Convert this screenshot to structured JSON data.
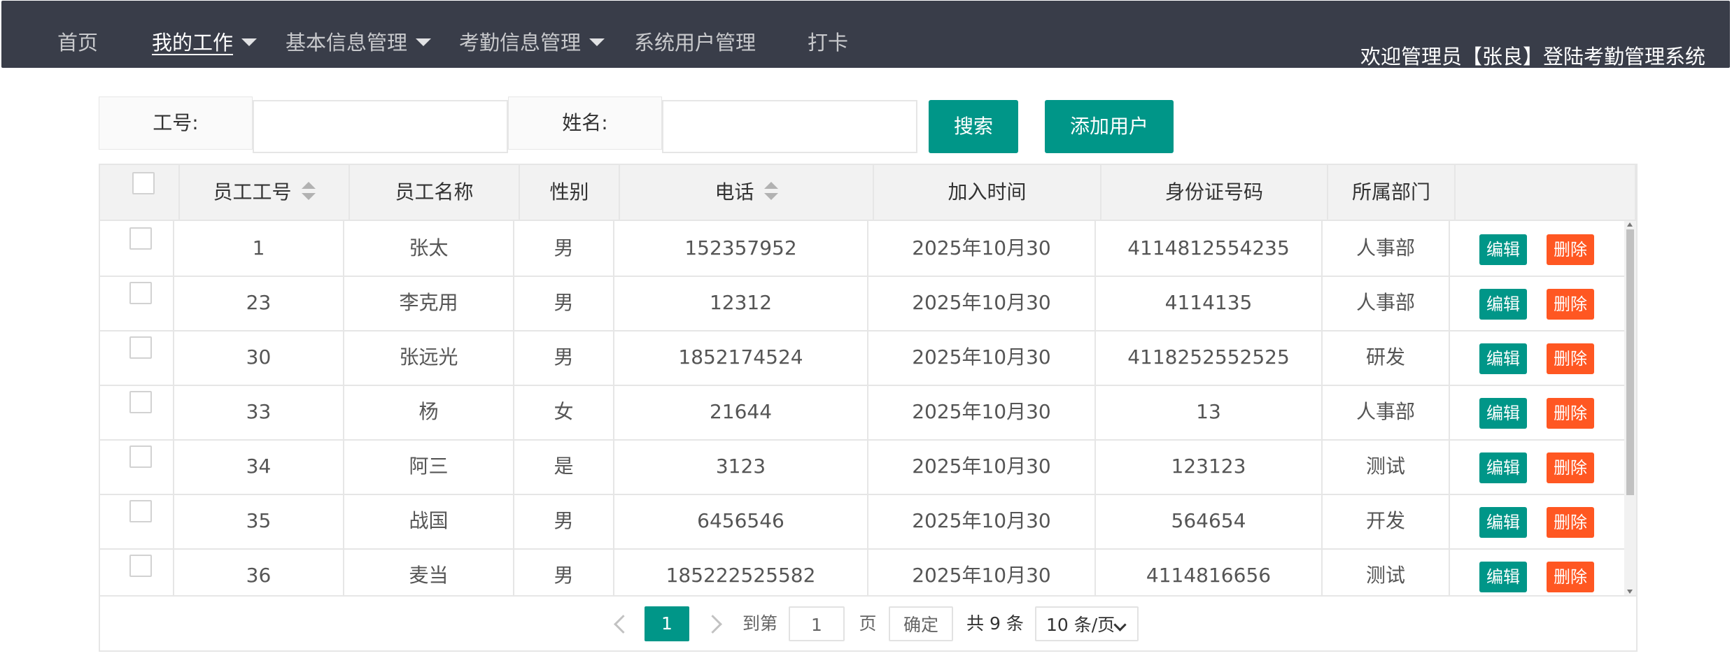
{
  "nav": {
    "items": [
      {
        "label": "首页",
        "dropdown": false,
        "active": false
      },
      {
        "label": "我的工作",
        "dropdown": true,
        "active": true
      },
      {
        "label": "基本信息管理",
        "dropdown": true,
        "active": false
      },
      {
        "label": "考勤信息管理",
        "dropdown": true,
        "active": false
      },
      {
        "label": "系统用户管理",
        "dropdown": false,
        "active": false
      },
      {
        "label": "打卡",
        "dropdown": false,
        "active": false
      }
    ],
    "welcome": "欢迎管理员【张良】登陆考勤管理系统"
  },
  "search": {
    "id_label": "工号:",
    "id_value": "",
    "name_label": "姓名:",
    "name_value": "",
    "search_button": "搜索",
    "add_button": "添加用户"
  },
  "table": {
    "columns": [
      "员工工号",
      "员工名称",
      "性别",
      "电话",
      "加入时间",
      "身份证号码",
      "所属部门"
    ],
    "edit_label": "编辑",
    "delete_label": "删除",
    "rows": [
      [
        "1",
        "张太",
        "男",
        "152357952",
        "2025年10月30",
        "4114812554235",
        "人事部"
      ],
      [
        "23",
        "李克用",
        "男",
        "12312",
        "2025年10月30",
        "4114135",
        "人事部"
      ],
      [
        "30",
        "张远光",
        "男",
        "1852174524",
        "2025年10月30",
        "4118252552525",
        "研发"
      ],
      [
        "33",
        "杨",
        "女",
        "21644",
        "2025年10月30",
        "13",
        "人事部"
      ],
      [
        "34",
        "阿三",
        "是",
        "3123",
        "2025年10月30",
        "123123",
        "测试"
      ],
      [
        "35",
        "战国",
        "男",
        "6456546",
        "2025年10月30",
        "564654",
        "开发"
      ],
      [
        "36",
        "麦当",
        "男",
        "185222525582",
        "2025年10月30",
        "4114816656",
        "测试"
      ]
    ]
  },
  "pager": {
    "current_page": "1",
    "goto_label": "到第",
    "goto_value": "1",
    "page_suffix": "页",
    "confirm": "确定",
    "total": "共 9 条",
    "page_size": "10 条/页"
  },
  "colors": {
    "nav_bg": "#393d49",
    "primary": "#009688",
    "danger": "#ff5722"
  }
}
